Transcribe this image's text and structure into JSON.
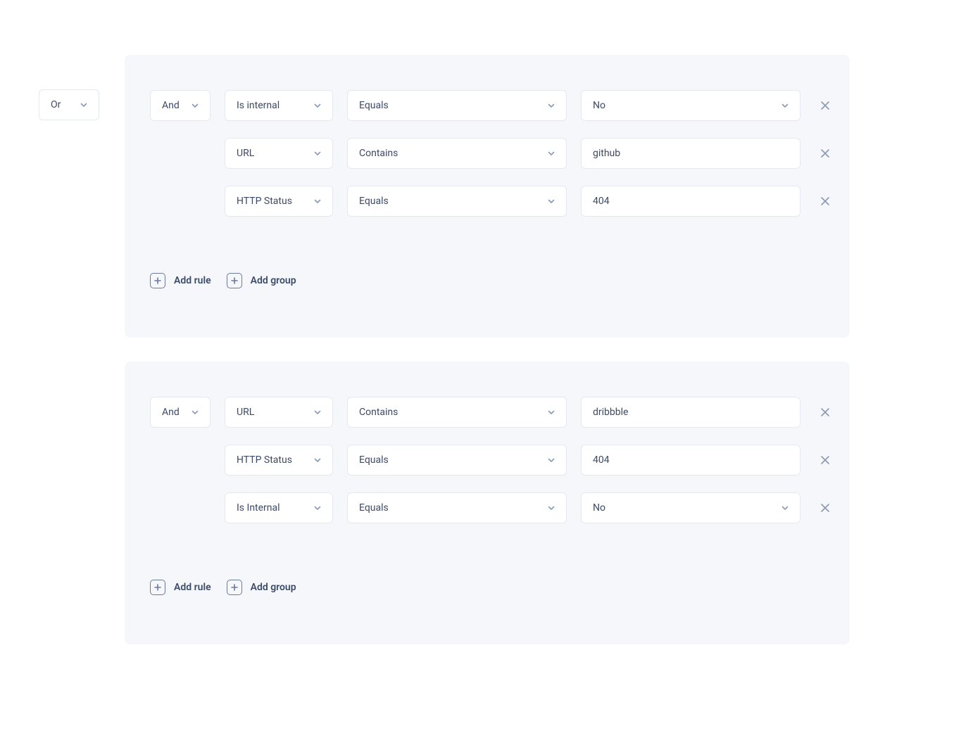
{
  "outer_combinator": "Or",
  "groups": [
    {
      "combinator": "And",
      "rules": [
        {
          "field": "Is internal",
          "operator": "Equals",
          "value": "No",
          "value_type": "select"
        },
        {
          "field": "URL",
          "operator": "Contains",
          "value": "github",
          "value_type": "text"
        },
        {
          "field": "HTTP Status",
          "operator": "Equals",
          "value": "404",
          "value_type": "text"
        }
      ]
    },
    {
      "combinator": "And",
      "rules": [
        {
          "field": "URL",
          "operator": "Contains",
          "value": "dribbble",
          "value_type": "text"
        },
        {
          "field": "HTTP Status",
          "operator": "Equals",
          "value": "404",
          "value_type": "text"
        },
        {
          "field": "Is Internal",
          "operator": "Equals",
          "value": "No",
          "value_type": "select"
        }
      ]
    }
  ],
  "actions": {
    "add_rule": "Add rule",
    "add_group": "Add group"
  }
}
